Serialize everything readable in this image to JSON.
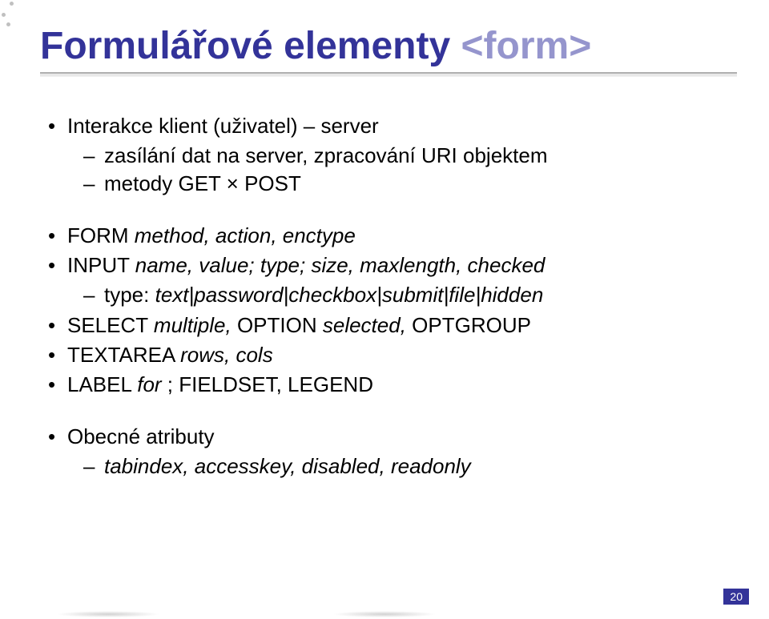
{
  "title": {
    "plain": "Formulářové elementy ",
    "code": "<form>"
  },
  "bullets": {
    "b1": "Interakce klient (uživatel) – server",
    "b1_1": "zasílání dat na server, zpracování URI objektem",
    "b1_2": "metody GET × POST",
    "b2_tag": "FORM ",
    "b2_attrs": "method, action, enctype",
    "b3_tag": "INPUT ",
    "b3_attrs": "name, value; type; size, maxlength, checked",
    "b3_1_label": "type: ",
    "b3_1_vals": "text|password|checkbox|submit|file|hidden",
    "b4_a": "SELECT ",
    "b4_a_attr": "multiple,",
    "b4_b": " OPTION ",
    "b4_b_attr": "selected,",
    "b4_c": " OPTGROUP",
    "b5_tag": "TEXTAREA ",
    "b5_attrs": "rows, cols",
    "b6_a": "LABEL ",
    "b6_a_attr": "for",
    "b6_sep": " ; ",
    "b6_b": "FIELDSET, LEGEND",
    "b7": "Obecné atributy",
    "b7_1": "tabindex, accesskey, disabled, readonly"
  },
  "page_number": "20"
}
